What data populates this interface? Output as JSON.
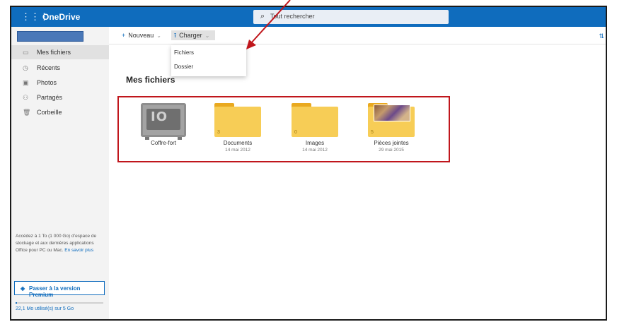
{
  "app": {
    "title": "OneDrive"
  },
  "search": {
    "placeholder": "Tout rechercher"
  },
  "sidebar": {
    "items": [
      {
        "label": "Mes fichiers",
        "icon": "folder-icon"
      },
      {
        "label": "Récents",
        "icon": "clock-icon"
      },
      {
        "label": "Photos",
        "icon": "image-icon"
      },
      {
        "label": "Partagés",
        "icon": "share-icon"
      },
      {
        "label": "Corbeille",
        "icon": "trash-icon"
      }
    ],
    "promo_text": "Accédez à 1 To (1 000 Go) d’espace de stockage et aux dernières applications Office pour PC ou Mac.",
    "promo_link": "En savoir plus",
    "premium_button": "Passer à la version Premium",
    "storage_text": "22,1 Mo utilisé(s) sur 5 Go",
    "storage_fraction": 0.0044
  },
  "toolbar": {
    "new_label": "Nouveau",
    "upload_label": "Charger"
  },
  "upload_menu": {
    "items": [
      "Fichiers",
      "Dossier"
    ]
  },
  "main": {
    "title": "Mes fichiers",
    "tiles": [
      {
        "name": "Coffre-fort",
        "date": "",
        "count": "",
        "type": "vault"
      },
      {
        "name": "Documents",
        "date": "14 mai 2012",
        "count": "3",
        "type": "folder"
      },
      {
        "name": "Images",
        "date": "14 mai 2012",
        "count": "0",
        "type": "folder"
      },
      {
        "name": "Pièces jointes",
        "date": "29 mai 2015",
        "count": "5",
        "type": "folder-image"
      }
    ]
  },
  "colors": {
    "accent": "#0f6cbd",
    "highlight": "#c0161c",
    "folder": "#f7cd56"
  }
}
